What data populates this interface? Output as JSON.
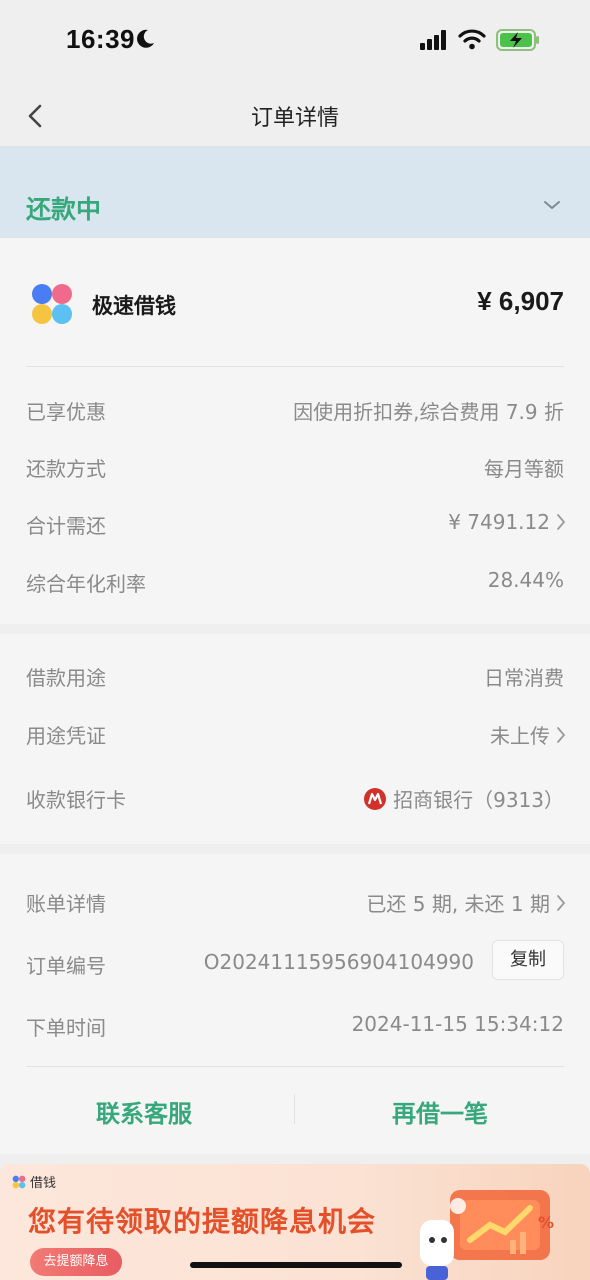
{
  "status_bar": {
    "time": "16:39"
  },
  "nav": {
    "title": "订单详情"
  },
  "order_status": {
    "label": "还款中"
  },
  "product": {
    "name": "极速借钱",
    "amount": "¥ 6,907"
  },
  "details": [
    {
      "label": "已享优惠",
      "value": "因使用折扣券,综合费用 7.9 折"
    },
    {
      "label": "还款方式",
      "value": "每月等额"
    },
    {
      "label": "合计需还",
      "value": "¥ 7491.12"
    },
    {
      "label": "综合年化利率",
      "value": "28.44%"
    }
  ],
  "loan": [
    {
      "label": "借款用途",
      "value": "日常消费"
    },
    {
      "label": "用途凭证",
      "value": "未上传"
    },
    {
      "label": "收款银行卡",
      "value": "招商银行（9313）"
    }
  ],
  "order": [
    {
      "label": "账单详情",
      "value": "已还 5 期, 未还 1 期"
    },
    {
      "label": "订单编号",
      "value": "O20241115956904104990"
    },
    {
      "label": "下单时间",
      "value": "2024-11-15 15:34:12"
    }
  ],
  "copy_label": "复制",
  "actions": {
    "contact": "联系客服",
    "borrow_again": "再借一笔"
  },
  "banner": {
    "brand": "借钱",
    "title": "您有待领取的提额降息机会",
    "button": "去提额降息",
    "badge": "%"
  },
  "colors": {
    "accent": "#36a87c",
    "status_band": "#d9e6ef",
    "banner_title": "#e4502a",
    "bank": "#d1302b"
  },
  "icons": [
    "moon-icon",
    "signal-icon",
    "wifi-icon",
    "battery-charging-icon",
    "back-chevron-icon",
    "chevron-down-icon",
    "chevron-right-icon",
    "app-logo-icon",
    "bank-logo-icon"
  ]
}
